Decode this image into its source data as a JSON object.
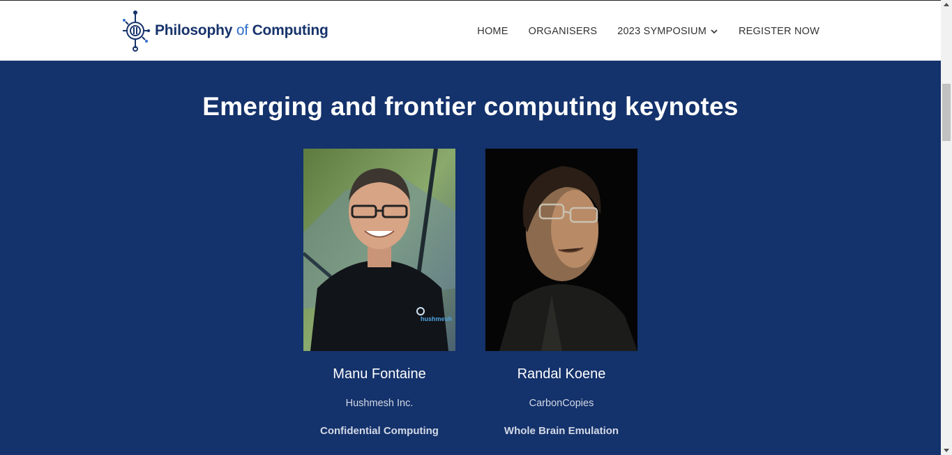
{
  "site": {
    "logo_main": "Philosophy",
    "logo_of": "of",
    "logo_tail": "Computing",
    "logo_icon": "circuit-brain-icon",
    "brand_color": "#17336b",
    "accent_color": "#2f6fcb"
  },
  "nav": {
    "items": [
      {
        "label": "HOME"
      },
      {
        "label": "ORGANISERS"
      },
      {
        "label": "2023 SYMPOSIUM",
        "icon": "chevron-down-icon"
      },
      {
        "label": "REGISTER NOW"
      }
    ]
  },
  "section": {
    "title": "Emerging and frontier computing keynotes",
    "background": "#14326b",
    "speakers": [
      {
        "name": "Manu Fontaine",
        "org": "Hushmesh Inc.",
        "topic": "Confidential Computing",
        "photo_badge": "hushmesh"
      },
      {
        "name": "Randal Koene",
        "org": "CarbonCopies",
        "topic": "Whole Brain Emulation"
      }
    ]
  }
}
